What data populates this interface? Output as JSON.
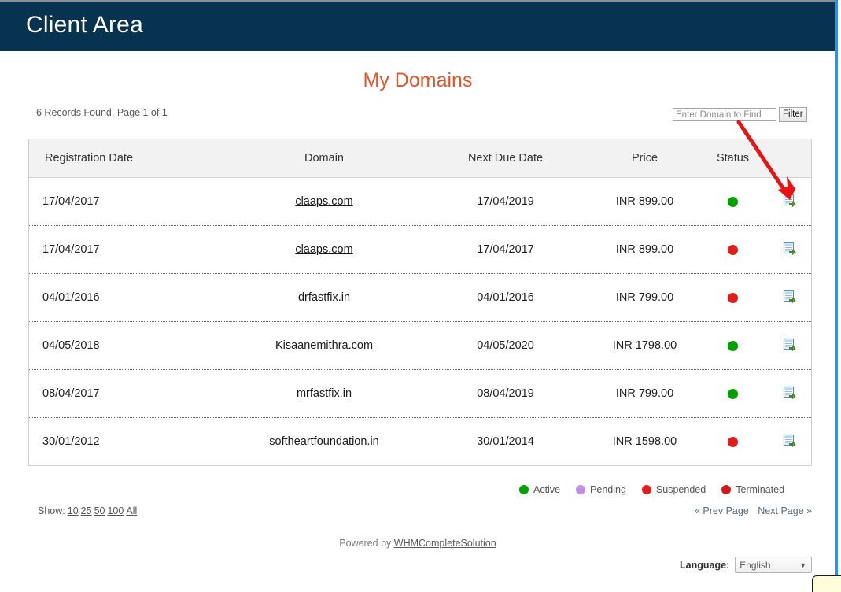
{
  "header": {
    "title": "Client Area",
    "bg_color": "#073350"
  },
  "page": {
    "title": "My Domains",
    "title_color": "#e0582a"
  },
  "meta": {
    "records_found": "6 Records Found, Page 1 of 1"
  },
  "filter": {
    "placeholder": "Enter Domain to Find",
    "value": "",
    "button_label": "Filter"
  },
  "table": {
    "columns": [
      "Registration Date",
      "Domain",
      "Next Due Date",
      "Price",
      "Status",
      ""
    ],
    "rows": [
      {
        "registration_date": "17/04/2017",
        "domain": "claaps.com",
        "next_due_date": "17/04/2019",
        "price": "INR 899.00",
        "status": "active",
        "action_icon": "manage-domain-icon"
      },
      {
        "registration_date": "17/04/2017",
        "domain": "claaps.com",
        "next_due_date": "17/04/2017",
        "price": "INR 899.00",
        "status": "suspended",
        "action_icon": "manage-domain-icon"
      },
      {
        "registration_date": "04/01/2016",
        "domain": "drfastfix.in",
        "next_due_date": "04/01/2016",
        "price": "INR 799.00",
        "status": "suspended",
        "action_icon": "manage-domain-icon"
      },
      {
        "registration_date": "04/05/2018",
        "domain": "Kisaanemithra.com",
        "next_due_date": "04/05/2020",
        "price": "INR 1798.00",
        "status": "active",
        "action_icon": "manage-domain-icon"
      },
      {
        "registration_date": "08/04/2017",
        "domain": "mrfastfix.in",
        "next_due_date": "08/04/2019",
        "price": "INR 799.00",
        "status": "active",
        "action_icon": "manage-domain-icon"
      },
      {
        "registration_date": "30/01/2012",
        "domain": "softheartfoundation.in",
        "next_due_date": "30/01/2014",
        "price": "INR 1598.00",
        "status": "suspended",
        "action_icon": "manage-domain-icon"
      }
    ]
  },
  "legend": [
    {
      "label": "Active",
      "color": "#00a000"
    },
    {
      "label": "Pending",
      "color": "#c08fe8"
    },
    {
      "label": "Suspended",
      "color": "#e21b1b"
    },
    {
      "label": "Terminated",
      "color": "#d81414"
    }
  ],
  "show": {
    "label": "Show:",
    "options": [
      "10",
      "25",
      "50",
      "100",
      "All"
    ]
  },
  "paging": {
    "prev": "« Prev Page",
    "next": "Next Page »"
  },
  "footer": {
    "prefix": "Powered by",
    "link": "WHMCompleteSolution"
  },
  "language": {
    "label": "Language:",
    "selected": "English",
    "caret": "▼"
  },
  "annotation": {
    "type": "arrow",
    "color": "#e81414"
  }
}
